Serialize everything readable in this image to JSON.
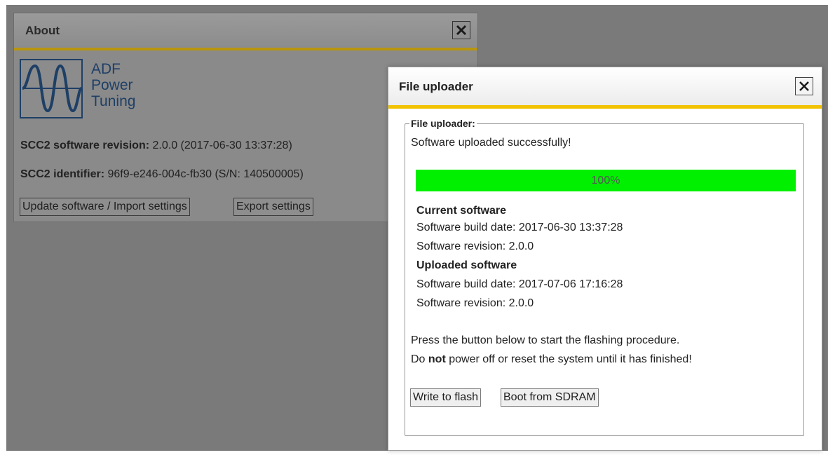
{
  "colors": {
    "backdrop": "#7a7a7a",
    "accent_bar": "#f2c200",
    "logo_blue": "#1e3f66",
    "progress_fill": "#00f000"
  },
  "about": {
    "title": "About",
    "close_icon": "close-icon",
    "logo": {
      "icon": "sine-wave-icon",
      "line1": "ADF",
      "line2": "Power",
      "line3": "Tuning"
    },
    "revision_label": "SCC2 software revision:",
    "revision_value": "2.0.0 (2017-06-30 13:37:28)",
    "identifier_label": "SCC2 identifier:",
    "identifier_value": "96f9-e246-004c-fb30 (S/N: 140500005)",
    "update_button": "Update software / Import settings",
    "export_button": "Export settings"
  },
  "uploader": {
    "title": "File uploader",
    "close_icon": "close-icon",
    "group_legend": "File uploader:",
    "status": "Software uploaded successfully!",
    "progress": {
      "value": 1.0,
      "label": "100%"
    },
    "current": {
      "heading": "Current software",
      "build_date": "Software build date: 2017-06-30 13:37:28",
      "revision": "Software revision: 2.0.0"
    },
    "uploaded": {
      "heading": "Uploaded software",
      "build_date": "Software build date: 2017-07-06 17:16:28",
      "revision": "Software revision: 2.0.0"
    },
    "instruction_line1": "Press the button below to start the flashing procedure.",
    "instruction_do": "Do ",
    "instruction_not": "not",
    "instruction_rest": " power off or reset the system until it has finished!",
    "write_button": "Write to flash",
    "boot_button": "Boot from SDRAM"
  }
}
